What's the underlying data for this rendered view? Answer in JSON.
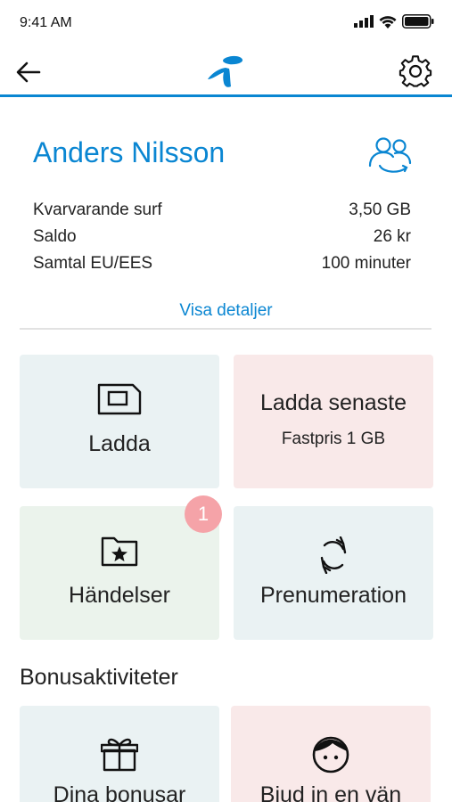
{
  "status_bar": {
    "time": "9:41 AM",
    "icons": [
      "signal-icon",
      "wifi-icon",
      "battery-icon"
    ]
  },
  "nav": {
    "back_icon": "arrow-left-icon",
    "logo": "telia-logo",
    "settings_icon": "gear-icon"
  },
  "colors": {
    "brand_blue": "#0a86d2",
    "tile_blue": "#eaf2f3",
    "tile_pink": "#f9e9e9",
    "tile_green": "#ebf3ec",
    "badge": "#f5a3a8"
  },
  "profile": {
    "name": "Anders Nilsson",
    "icon": "users-switch-icon",
    "rows": [
      {
        "label": "Kvarvarande surf",
        "value": "3,50 GB"
      },
      {
        "label": "Saldo",
        "value": "26 kr"
      },
      {
        "label": "Samtal EU/EES",
        "value": "100 minuter"
      }
    ],
    "details_link": "Visa detaljer"
  },
  "tiles": [
    {
      "title": "Ladda",
      "icon": "sim-card-icon"
    },
    {
      "title": "Ladda senaste",
      "subtitle": "Fastpris 1 GB"
    },
    {
      "title": "Händelser",
      "icon": "folder-star-icon",
      "badge": "1"
    },
    {
      "title": "Prenumeration",
      "icon": "refresh-icon"
    }
  ],
  "bonus": {
    "section_title": "Bonusaktiviteter",
    "tiles": [
      {
        "title": "Dina bonusar",
        "icon": "gift-icon"
      },
      {
        "title": "Bjud in en vän",
        "icon": "face-icon"
      }
    ]
  }
}
